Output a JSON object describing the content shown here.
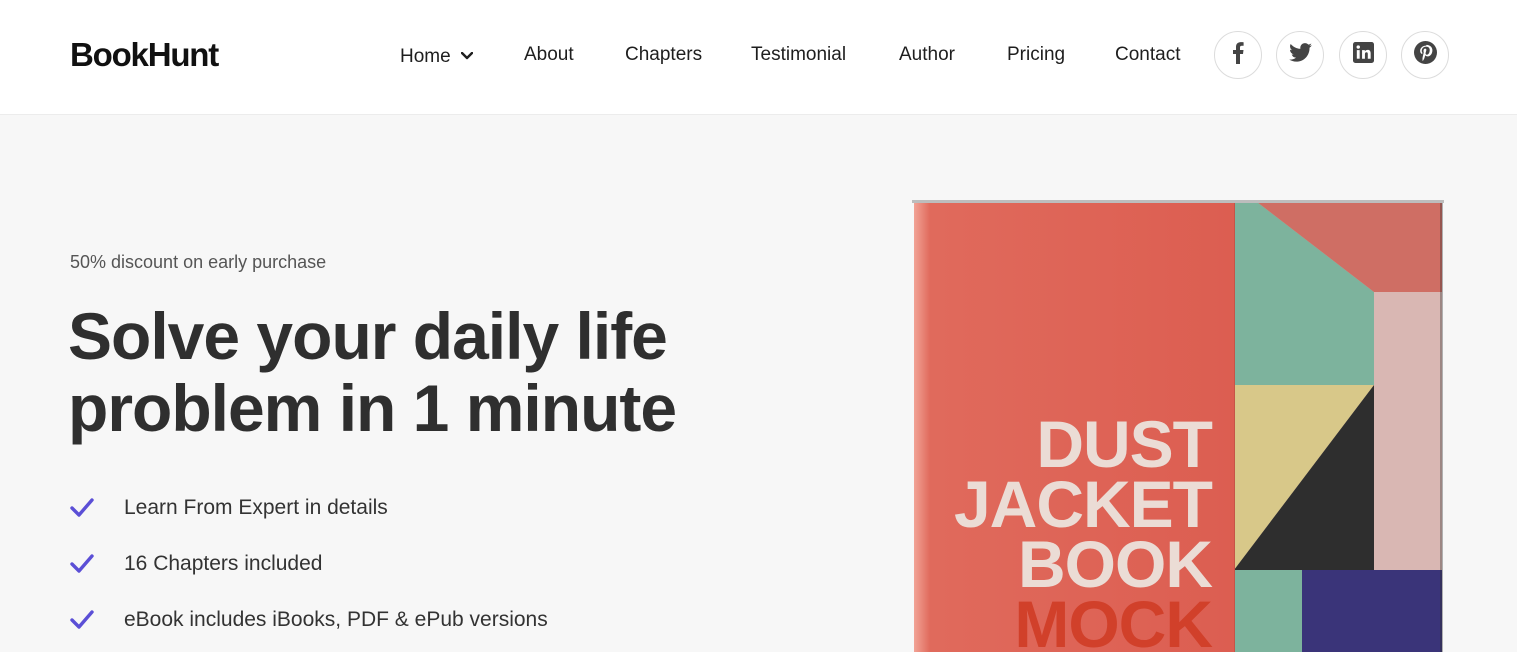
{
  "header": {
    "logo": "BookHunt",
    "nav": [
      {
        "label": "Home"
      },
      {
        "label": "About"
      },
      {
        "label": "Chapters"
      },
      {
        "label": "Testimonial"
      },
      {
        "label": "Author"
      },
      {
        "label": "Pricing"
      },
      {
        "label": "Contact"
      }
    ],
    "social_icons": [
      "facebook-icon",
      "twitter-icon",
      "linkedin-icon",
      "pinterest-icon"
    ]
  },
  "hero": {
    "eyebrow": "50% discount on early purchase",
    "headline_line1": "Solve your daily life",
    "headline_line2": "problem in 1 minute",
    "features": [
      "Learn From Expert in details",
      "16 Chapters included",
      "eBook includes iBooks, PDF & ePub versions"
    ],
    "check_color": "#5b4fd6"
  },
  "book": {
    "title_lines": [
      "DUST",
      "JACKET",
      "BOOK",
      "MOCK"
    ],
    "cover_color": "#e0665a"
  }
}
